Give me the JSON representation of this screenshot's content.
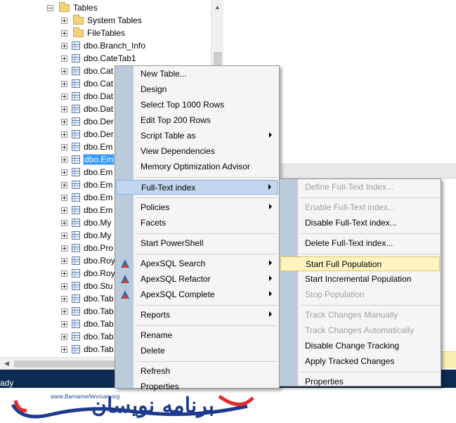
{
  "explorer": {
    "tables_folder": "Tables",
    "rows": [
      {
        "label": "System Tables",
        "kind": "folder"
      },
      {
        "label": "FileTables",
        "kind": "folder"
      },
      {
        "label": "dbo.Branch_Info",
        "kind": "table"
      },
      {
        "label": "dbo.CateTab1",
        "kind": "table"
      },
      {
        "label": "dbo.Cat",
        "kind": "table"
      },
      {
        "label": "dbo.Cat",
        "kind": "table"
      },
      {
        "label": "dbo.Dat",
        "kind": "table"
      },
      {
        "label": "dbo.Dat",
        "kind": "table"
      },
      {
        "label": "dbo.Der",
        "kind": "table"
      },
      {
        "label": "dbo.Der",
        "kind": "table"
      },
      {
        "label": "dbo.Em",
        "kind": "table"
      },
      {
        "label": "dbo.Em",
        "kind": "table",
        "selected": true
      },
      {
        "label": "dbo.Em",
        "kind": "table"
      },
      {
        "label": "dbo.Em",
        "kind": "table"
      },
      {
        "label": "dbo.Em",
        "kind": "table"
      },
      {
        "label": "dbo.Em",
        "kind": "table"
      },
      {
        "label": "dbo.My",
        "kind": "table"
      },
      {
        "label": "dbo.My",
        "kind": "table"
      },
      {
        "label": "dbo.Pro",
        "kind": "table"
      },
      {
        "label": "dbo.Roy",
        "kind": "table"
      },
      {
        "label": "dbo.Roy",
        "kind": "table"
      },
      {
        "label": "dbo.Stu",
        "kind": "table"
      },
      {
        "label": "dbo.Tab",
        "kind": "table"
      },
      {
        "label": "dbo.Tab",
        "kind": "table"
      },
      {
        "label": "dbo.Tab",
        "kind": "table"
      },
      {
        "label": "dbo.Tab",
        "kind": "table"
      },
      {
        "label": "dbo.Tab",
        "kind": "table"
      }
    ]
  },
  "status_bar": {
    "text": "ady",
    "background": "#0c2a52"
  },
  "context_menu": {
    "items": [
      {
        "label": "New Table..."
      },
      {
        "label": "Design"
      },
      {
        "label": "Select Top 1000 Rows"
      },
      {
        "label": "Edit Top 200 Rows"
      },
      {
        "label": "Script Table as",
        "submenu": true
      },
      {
        "label": "View Dependencies"
      },
      {
        "label": "Memory Optimization Advisor"
      },
      {
        "separator": true
      },
      {
        "label": "Full-Text index",
        "submenu": true,
        "highlighted": true
      },
      {
        "separator": true
      },
      {
        "label": "Policies",
        "submenu": true
      },
      {
        "label": "Facets"
      },
      {
        "separator": true
      },
      {
        "label": "Start PowerShell"
      },
      {
        "separator": true
      },
      {
        "label": "ApexSQL Search",
        "submenu": true,
        "icon": "apexsql-icon"
      },
      {
        "label": "ApexSQL Refactor",
        "submenu": true,
        "icon": "apexsql-icon"
      },
      {
        "label": "ApexSQL Complete",
        "submenu": true,
        "icon": "apexsql-icon"
      },
      {
        "separator": true
      },
      {
        "label": "Reports",
        "submenu": true
      },
      {
        "separator": true
      },
      {
        "label": "Rename"
      },
      {
        "label": "Delete"
      },
      {
        "separator": true
      },
      {
        "label": "Refresh"
      },
      {
        "label": "Properties"
      }
    ]
  },
  "fulltext_submenu": {
    "items": [
      {
        "label": "Define Full-Text Index...",
        "disabled": true
      },
      {
        "separator": true
      },
      {
        "label": "Enable Full-Text index...",
        "disabled": true
      },
      {
        "label": "Disable Full-Text index..."
      },
      {
        "separator": true
      },
      {
        "label": "Delete Full-Text index..."
      },
      {
        "separator": true
      },
      {
        "label": "Start Full Population",
        "hovered": true
      },
      {
        "label": "Start Incremental Population"
      },
      {
        "label": "Stop Population",
        "disabled": true
      },
      {
        "separator": true
      },
      {
        "label": "Track Changes Manually",
        "disabled": true
      },
      {
        "label": "Track Changes Automatically",
        "disabled": true
      },
      {
        "label": "Disable Change Tracking"
      },
      {
        "label": "Apply Tracked Changes"
      },
      {
        "separator": true
      },
      {
        "label": "Properties"
      }
    ]
  },
  "watermark": {
    "url": "www.BarnameNevisan.org",
    "brand": "برنامه نویسان"
  },
  "colors": {
    "selection": "#3399ff",
    "menu_highlight": "#c2d6ef",
    "submenu_hover": "#fdf4bf",
    "menu_gutter": "#bccbdb"
  }
}
